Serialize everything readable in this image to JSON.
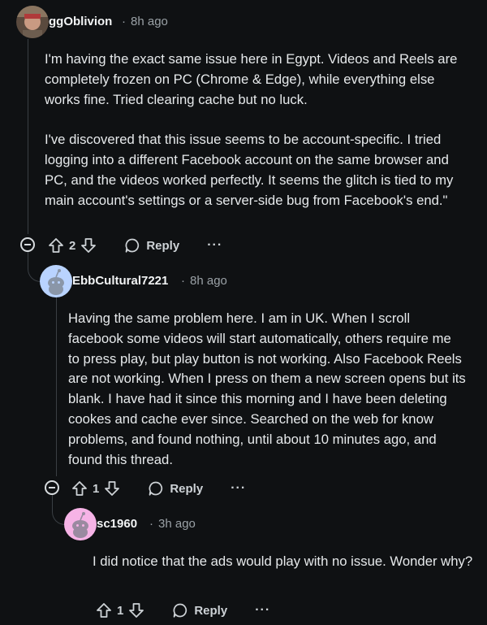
{
  "comments": [
    {
      "username": "ggOblivion",
      "time": "8h ago",
      "paragraphs": [
        "I'm having the exact same issue here in Egypt. Videos and Reels are completely frozen on PC (Chrome & Edge), while everything else works fine. Tried clearing cache but no luck.",
        "I've discovered that this issue seems to be account-specific. I tried logging into a different Facebook account on the same browser and PC, and the videos worked perfectly. It seems the glitch is tied to my main account's settings or a server-side bug from Facebook's end.\""
      ],
      "votes": "2",
      "reply_label": "Reply",
      "more_label": "···"
    },
    {
      "username": "EbbCultural7221",
      "time": "8h ago",
      "paragraphs": [
        "Having the same problem here. I am in UK. When I scroll facebook some videos will start automatically, others require me to press play, but play button is not working. Also Facebook Reels are not working. When I press on them a new screen opens but its blank. I have had it since this morning and I have been deleting cookes and cache ever since. Searched on the web for know problems, and found nothing, until about 10 minutes ago, and found this thread."
      ],
      "votes": "1",
      "reply_label": "Reply",
      "more_label": "···"
    },
    {
      "username": "sc1960",
      "time": "3h ago",
      "paragraphs": [
        "I did notice that the ads would play with no issue. Wonder why?"
      ],
      "votes": "1",
      "reply_label": "Reply",
      "more_label": "···"
    }
  ],
  "separator": "·",
  "colors": {
    "background": "#0f1113",
    "text": "#e6e9eb",
    "meta": "#9aa1a6",
    "thread_line": "#3a3f44",
    "avatar_blue": "#b9d3ff",
    "avatar_pink": "#f6b3e6"
  }
}
